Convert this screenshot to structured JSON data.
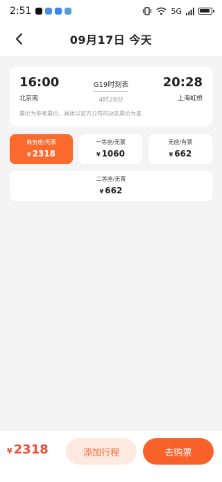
{
  "status_bar": {
    "time": "2:51",
    "app_icons": [
      {
        "name": "tiktok-icon",
        "color": "#111111"
      },
      {
        "name": "app-icon",
        "color": "#4a90e2"
      },
      {
        "name": "cloud-icon",
        "color": "#3b82f6"
      },
      {
        "name": "app-icon-2",
        "color": "#5b9bd5"
      }
    ],
    "network": "5G",
    "icons": [
      "vibrate-icon",
      "wifi-icon",
      "signal-icon",
      "battery-icon"
    ]
  },
  "header": {
    "title": "09月17日 今天",
    "back_icon": "chevron-left-icon"
  },
  "train": {
    "departure_time": "16:00",
    "departure_station": "北京南",
    "arrival_time": "20:28",
    "arrival_station": "上海虹桥",
    "train_schedule": "G19时刻表",
    "duration": "4时28分",
    "price_note": "票价为参考票价，具体以官方公布的动态票价为准"
  },
  "seats": [
    {
      "label": "商务座/无票",
      "currency": "¥",
      "price": "2318",
      "selected": true
    },
    {
      "label": "一等座/无票",
      "currency": "¥",
      "price": "1060",
      "selected": false
    },
    {
      "label": "无座/有票",
      "currency": "¥",
      "price": "662",
      "selected": false
    },
    {
      "label": "二等座/无票",
      "currency": "¥",
      "price": "662",
      "selected": false
    }
  ],
  "bottom": {
    "currency": "¥",
    "total": "2318",
    "add_label": "添加行程",
    "buy_label": "去购票"
  },
  "colors": {
    "accent": "#fa6a2d",
    "price_red": "#e8523c",
    "add_bg": "#fde9e0"
  }
}
